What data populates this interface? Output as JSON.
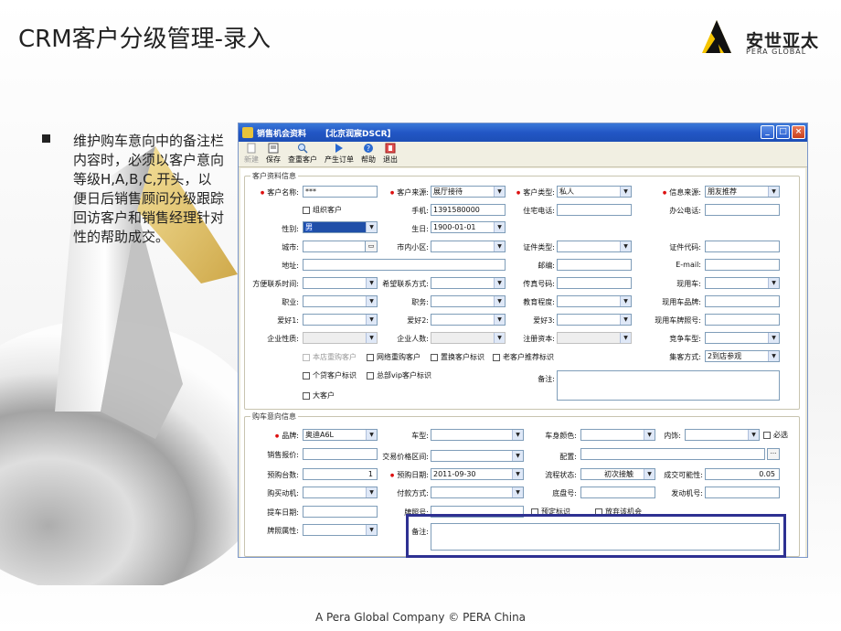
{
  "slide": {
    "title": "CRM客户分级管理-录入",
    "logo_text": "安世亚太",
    "logo_sub": "PERA GLOBAL",
    "bullet": "维护购车意向中的备注栏内容时，必须以客户意向等级H,A,B,C,开头，以便日后销售顾问分级跟踪回访客户和销售经理针对性的帮助成交。",
    "footer": "A Pera Global Company ©  PERA China"
  },
  "window": {
    "title": "销售机会资料",
    "subtitle": "【北京润宸DSCR】",
    "controls": {
      "minimize": "_",
      "maximize": "□",
      "close": "×"
    }
  },
  "toolbar": {
    "items": [
      {
        "label": "新建",
        "icon": "new-doc-icon",
        "enabled": false
      },
      {
        "label": "保存",
        "icon": "save-icon",
        "enabled": true
      },
      {
        "label": "查重客户",
        "icon": "duplicate-check-icon",
        "enabled": true
      },
      {
        "label": "产生订单",
        "icon": "order-icon",
        "enabled": true
      },
      {
        "label": "帮助",
        "icon": "help-icon",
        "enabled": true
      },
      {
        "label": "退出",
        "icon": "exit-icon",
        "enabled": true
      }
    ]
  },
  "customer": {
    "group_label": "客户资料信息",
    "name_label": "客户名称:",
    "name_value": "***",
    "source_label": "客户来源:",
    "source_value": "展厅接待",
    "type_label": "客户类型:",
    "type_value": "私人",
    "info_src_label": "信息来源:",
    "info_src_value": "朋友推荐",
    "org_label": "组织客户",
    "mobile_label": "手机:",
    "mobile_value": "1391580000",
    "home_phone_label": "住宅电话:",
    "office_phone_label": "办公电话:",
    "gender_label": "性别:",
    "gender_value": "男",
    "birthday_label": "生日:",
    "birthday_value": "1900-01-01",
    "city_label": "城市:",
    "district_label": "市内小区:",
    "id_type_label": "证件类型:",
    "id_code_label": "证件代码:",
    "address_label": "地址:",
    "postcode_label": "邮编:",
    "email_label": "E-mail:",
    "contact_time_label": "方便联系时间:",
    "contact_way_label": "希望联系方式:",
    "fax_label": "传真号码:",
    "current_car_label": "现用车:",
    "job_label": "职业:",
    "position_label": "职务:",
    "education_label": "教育程度:",
    "car_brand_label": "现用车品牌:",
    "hobby1_label": "爱好1:",
    "hobby2_label": "爱好2:",
    "hobby3_label": "爱好3:",
    "plate_label": "现用车牌照号:",
    "company_type_label": "企业性质:",
    "company_size_label": "企业人数:",
    "capital_label": "注册资本:",
    "rival_car_label": "竞争车型:",
    "store_reorder_label": "本店重购客户",
    "web_reorder_label": "网络重购客户",
    "replace_label": "置换客户标识",
    "old_referral_label": "老客户推荐标识",
    "gather_label": "集客方式:",
    "gather_value": "2到店参观",
    "personal_mark_label": "个贷客户标识",
    "vip_label": "总部vip客户标识",
    "remark_label": "备注:",
    "big_customer_label": "大客户"
  },
  "intent": {
    "group_label": "购车意向信息",
    "brand_label": "品牌:",
    "brand_value": "奥迪A6L",
    "model_label": "车型:",
    "color_label": "车身颜色:",
    "interior_label": "内饰:",
    "must_label": "必选",
    "quote_label": "销售报价:",
    "price_range_label": "交易价格区间:",
    "config_label": "配置:",
    "count_label": "预购台数:",
    "count_value": "1",
    "date_label": "预购日期:",
    "date_value": "2011-09-30",
    "status_label": "流程状态:",
    "status_value": "初次接触",
    "probability_label": "成交可能性:",
    "probability_value": "0.05",
    "motive_label": "购买动机:",
    "payment_label": "付款方式:",
    "chassis_label": "底盘号:",
    "engine_label": "发动机号:",
    "pickup_label": "提车日期:",
    "plate_no_label": "牌照号:",
    "reserve_label": "预定标识",
    "give_up_label": "放弃该机会",
    "plate_attr_label": "牌照属性:",
    "remark_label": "备注:"
  }
}
